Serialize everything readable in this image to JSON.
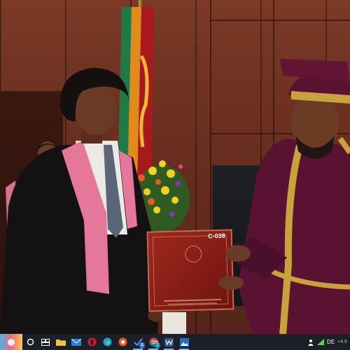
{
  "photo": {
    "certificate_label": "C-038"
  },
  "taskbar": {
    "items": [
      {
        "name": "start",
        "icon": "start-icon"
      },
      {
        "name": "search",
        "icon": "search-icon"
      },
      {
        "name": "task-view",
        "icon": "task-view-icon"
      },
      {
        "name": "file-explorer",
        "icon": "folder-icon"
      },
      {
        "name": "mail",
        "icon": "mail-icon"
      },
      {
        "name": "opera",
        "icon": "opera-icon"
      },
      {
        "name": "edge",
        "icon": "edge-icon"
      },
      {
        "name": "brave",
        "icon": "brave-icon"
      },
      {
        "name": "tasks",
        "icon": "tasks-icon",
        "badge": "6"
      },
      {
        "name": "chrome",
        "icon": "chrome-icon",
        "badge": "2"
      },
      {
        "name": "word",
        "icon": "word-icon"
      },
      {
        "name": "photos",
        "icon": "photos-icon"
      }
    ],
    "tray": {
      "language": "DE",
      "network_meter": "+4.6"
    }
  },
  "colors": {
    "taskbar_bg": "#1b1f27",
    "wall": "#6a2f1f",
    "robe": "#5a1232"
  }
}
